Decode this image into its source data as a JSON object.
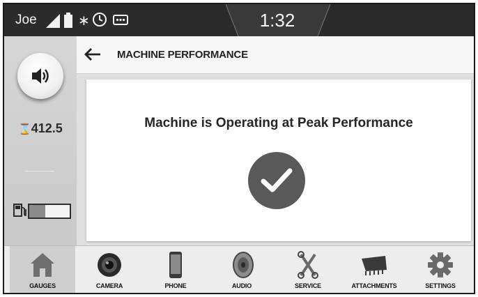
{
  "status_bar": {
    "user": "Joe",
    "time": "1:32",
    "icons": [
      "signal-icon",
      "battery-icon",
      "bluetooth-icon",
      "clock-icon",
      "message-icon"
    ]
  },
  "left_panel": {
    "volume_icon": "speaker-icon",
    "hours_value": "412.5",
    "hours_icon": "hourglass-icon",
    "fuel_icon": "fuel-pump-icon",
    "fuel_level": 0.4
  },
  "header": {
    "back_icon": "back-arrow-icon",
    "title": "MACHINE PERFORMANCE"
  },
  "main": {
    "message": "Machine is Operating at Peak Performance",
    "status_icon": "checkmark-icon"
  },
  "bottom_nav": {
    "active": "GAUGES",
    "items": [
      {
        "label": "GAUGES",
        "icon": "house-icon"
      },
      {
        "label": "CAMERA",
        "icon": "camera-icon"
      },
      {
        "label": "PHONE",
        "icon": "phone-icon"
      },
      {
        "label": "AUDIO",
        "icon": "speaker-cone-icon"
      },
      {
        "label": "SERVICE",
        "icon": "wrench-icon"
      },
      {
        "label": "ATTACHMENTS",
        "icon": "bucket-icon"
      },
      {
        "label": "SETTINGS",
        "icon": "gear-icon"
      }
    ]
  },
  "colors": {
    "status_bar_bg": "#2b2b2b",
    "check_circle": "#595959",
    "panel_bg": "#d2d2d2"
  }
}
